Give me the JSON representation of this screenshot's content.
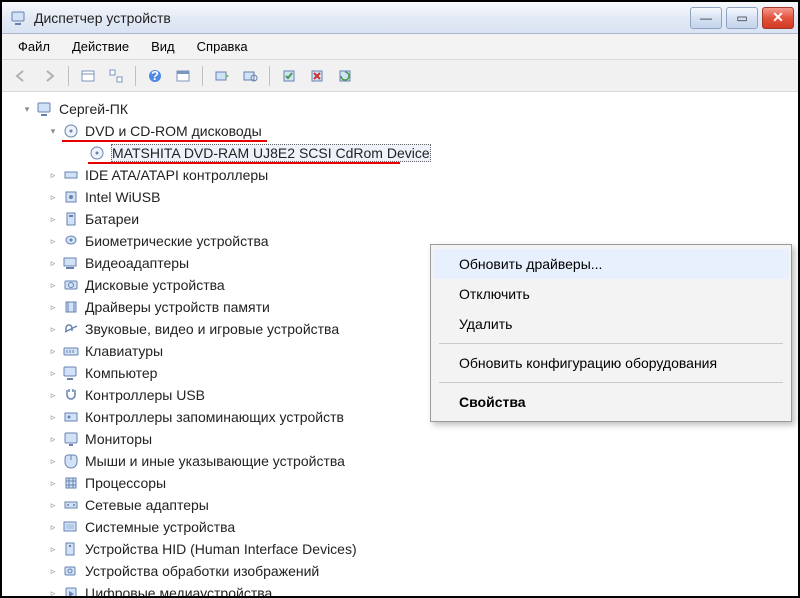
{
  "window": {
    "title": "Диспетчер устройств",
    "minimize_glyph": "—",
    "maximize_glyph": "▭",
    "close_glyph": "✕"
  },
  "menu": {
    "file": "Файл",
    "action": "Действие",
    "view": "Вид",
    "help": "Справка"
  },
  "tree": {
    "root": "Сергей-ПК",
    "dvd_category": "DVD и CD-ROM дисководы",
    "dvd_device": "MATSHITA DVD-RAM UJ8E2 SCSI CdRom Device",
    "items": [
      "IDE ATA/ATAPI контроллеры",
      "Intel WiUSB",
      "Батареи",
      "Биометрические устройства",
      "Видеоадаптеры",
      "Дисковые устройства",
      "Драйверы устройств памяти",
      "Звуковые, видео и игровые устройства",
      "Клавиатуры",
      "Компьютер",
      "Контроллеры USB",
      "Контроллеры запоминающих устройств",
      "Мониторы",
      "Мыши и иные указывающие устройства",
      "Процессоры",
      "Сетевые адаптеры",
      "Системные устройства",
      "Устройства HID (Human Interface Devices)",
      "Устройства обработки изображений",
      "Цифровые медиаустройства"
    ]
  },
  "context_menu": {
    "update_drivers": "Обновить драйверы...",
    "disable": "Отключить",
    "delete": "Удалить",
    "scan_hw": "Обновить конфигурацию оборудования",
    "properties": "Свойства"
  },
  "glyphs": {
    "collapse": "▾",
    "expand": "▹"
  }
}
